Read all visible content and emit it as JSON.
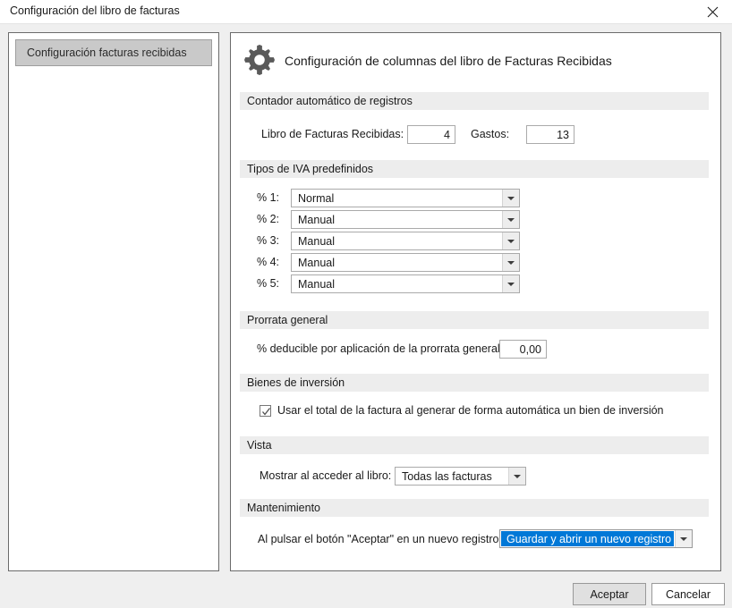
{
  "window": {
    "title": "Configuración del libro de facturas",
    "close_icon": "close-icon"
  },
  "sidebar": {
    "items": [
      {
        "label": "Configuración facturas recibidas",
        "selected": true
      }
    ]
  },
  "main": {
    "icon": "gear-icon",
    "title": "Configuración de columnas del libro de Facturas Recibidas",
    "sections": [
      {
        "key": "contador",
        "title": "Contador automático de registros",
        "fields": [
          {
            "label": "Libro de Facturas Recibidas:",
            "value": "4"
          },
          {
            "label": "Gastos:",
            "value": "13"
          }
        ]
      },
      {
        "key": "iva",
        "title": "Tipos de IVA predefinidos",
        "rows": [
          {
            "label": "% 1:",
            "value": "Normal"
          },
          {
            "label": "% 2:",
            "value": "Manual"
          },
          {
            "label": "% 3:",
            "value": "Manual"
          },
          {
            "label": "% 4:",
            "value": "Manual"
          },
          {
            "label": "% 5:",
            "value": "Manual"
          }
        ]
      },
      {
        "key": "prorrata",
        "title": "Prorrata general",
        "field": {
          "label": "% deducible por aplicación de la prorrata general:",
          "value": "0,00"
        }
      },
      {
        "key": "bienes",
        "title": "Bienes de inversión",
        "checkbox": {
          "label": "Usar el total de la factura al generar de forma automática un bien de inversión",
          "checked": true
        }
      },
      {
        "key": "vista",
        "title": "Vista",
        "field": {
          "label": "Mostrar al acceder al libro:",
          "value": "Todas las facturas"
        }
      },
      {
        "key": "mantenimiento",
        "title": "Mantenimiento",
        "field": {
          "label": "Al pulsar el botón \"Aceptar\" en un nuevo registro:",
          "value": "Guardar y abrir un nuevo registro",
          "selected": true
        }
      }
    ]
  },
  "footer": {
    "accept_label": "Aceptar",
    "cancel_label": "Cancelar"
  },
  "colors": {
    "selection_blue": "#0078d7",
    "section_band": "#ededed",
    "sidebar_selected": "#c9c9c9",
    "panel_border": "#6b6b6b"
  }
}
